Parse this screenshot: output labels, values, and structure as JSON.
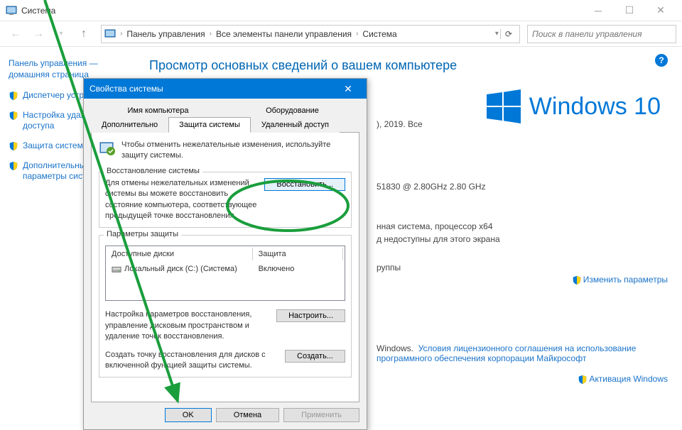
{
  "window": {
    "title": "Система",
    "search_placeholder": "Поиск в панели управления"
  },
  "breadcrumb": {
    "items": [
      "Панель управления",
      "Все элементы панели управления",
      "Система"
    ]
  },
  "sidebar": {
    "home": "Панель управления — домашняя страница",
    "tasks": [
      "Диспетчер устройств",
      "Настройка удаленного доступа",
      "Защита системы",
      "Дополнительные параметры системы"
    ]
  },
  "content": {
    "heading": "Просмотр основных сведений о вашем компьютере",
    "copyright_partial": "), 2019. Все",
    "cpu_partial": "51830 @ 2.80GHz   2.80 GHz",
    "arch_partial": "нная система, процессор x64",
    "pen_partial": "д недоступны для этого экрана",
    "group_partial": "руппы",
    "windows_partial": "Windows.",
    "change_link": "Изменить параметры",
    "license_link": "Условия лицензионного соглашения на использование программного обеспечения корпорации Майкрософт",
    "activate_link": "Активация Windows",
    "win10_text": "Windows 10"
  },
  "dialog": {
    "title": "Свойства системы",
    "tabs": {
      "row1": [
        "Имя компьютера",
        "Оборудование"
      ],
      "row2": [
        "Дополнительно",
        "Защита системы",
        "Удаленный доступ"
      ]
    },
    "protect_msg": "Чтобы отменить нежелательные изменения, используйте защиту системы.",
    "restore": {
      "group_title": "Восстановление системы",
      "desc": "Для отмены нежелательных изменений системы вы можете восстановить состояние компьютера, соответствующее предыдущей точке восстановления.",
      "button": "Восстановить..."
    },
    "params": {
      "group_title": "Параметры защиты",
      "col1": "Доступные диски",
      "col2": "Защита",
      "disk_name": "Локальный диск (C:) (Система)",
      "disk_status": "Включено",
      "config_desc": "Настройка параметров восстановления, управление дисковым пространством и удаление точек восстановления.",
      "config_btn": "Настроить...",
      "create_desc": "Создать точку восстановления для дисков с включенной функцией защиты системы.",
      "create_btn": "Создать..."
    },
    "buttons": {
      "ok": "OK",
      "cancel": "Отмена",
      "apply": "Применить"
    }
  }
}
